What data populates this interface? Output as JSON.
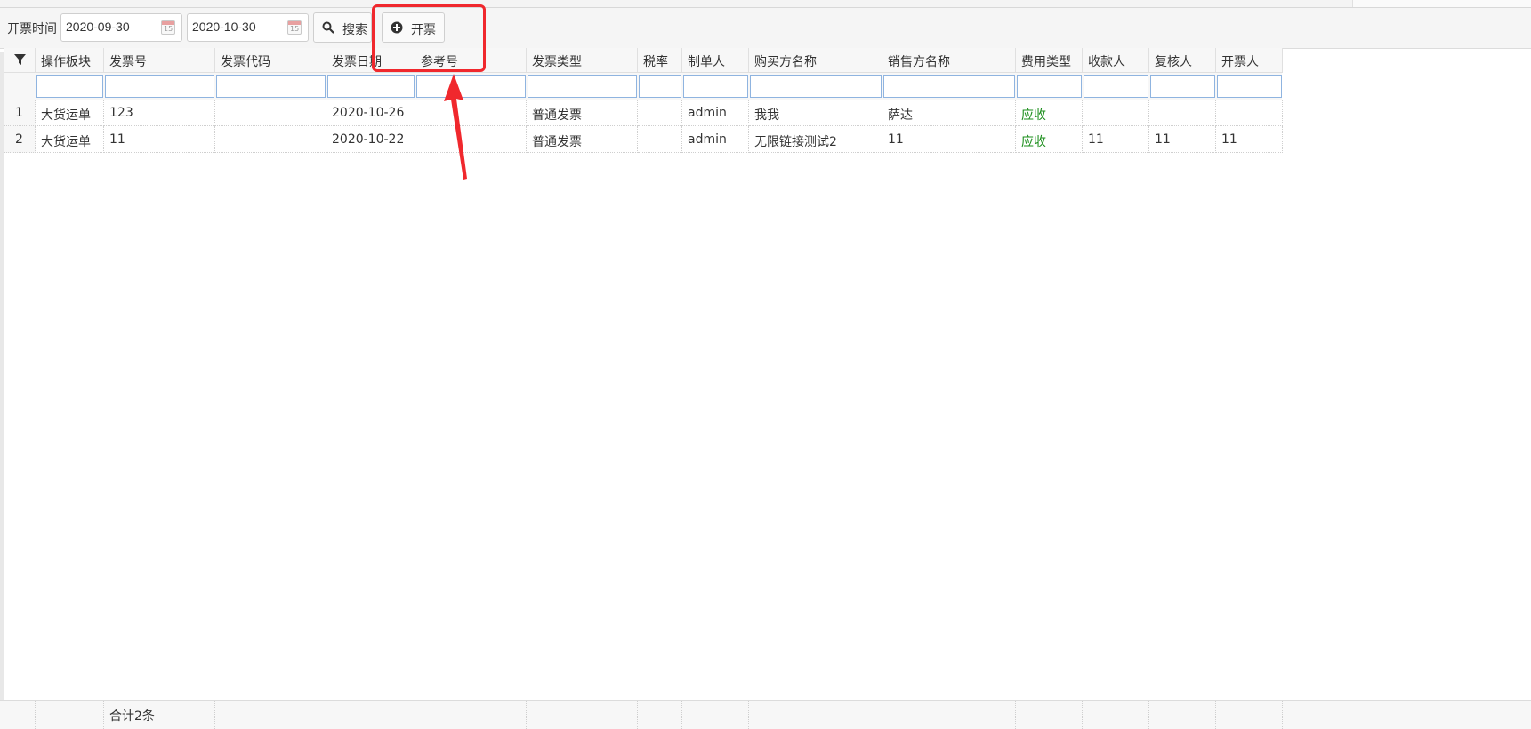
{
  "toolbar": {
    "date_label": "开票时间",
    "start_date": "2020-09-30",
    "end_date": "2020-10-30",
    "search_label": "搜索",
    "invoice_label": "开票",
    "cal_glyph": "15"
  },
  "table": {
    "columns": [
      "操作板块",
      "发票号",
      "发票代码",
      "发票日期",
      "参考号",
      "发票类型",
      "税率",
      "制单人",
      "购买方名称",
      "销售方名称",
      "费用类型",
      "收款人",
      "复核人",
      "开票人"
    ],
    "rows": [
      {
        "num": "1",
        "cells": [
          "大货运单",
          "123",
          "",
          "2020-10-26",
          "",
          "普通发票",
          "",
          "admin",
          "我我",
          "萨达",
          "应收",
          "",
          "",
          ""
        ]
      },
      {
        "num": "2",
        "cells": [
          "大货运单",
          "11",
          "",
          "2020-10-22",
          "",
          "普通发票",
          "",
          "admin",
          "无限链接测试2",
          "11",
          "应收",
          "11",
          "11",
          "11"
        ]
      }
    ],
    "footer_total": "合计2条"
  },
  "colors": {
    "highlight": "#f0282d",
    "receivable_green": "#1a8d1a",
    "filter_border": "#8fb4e0"
  },
  "icons": [
    "calendar-icon",
    "search-icon",
    "plus-circle-icon",
    "filter-icon",
    "annotation-arrow"
  ]
}
